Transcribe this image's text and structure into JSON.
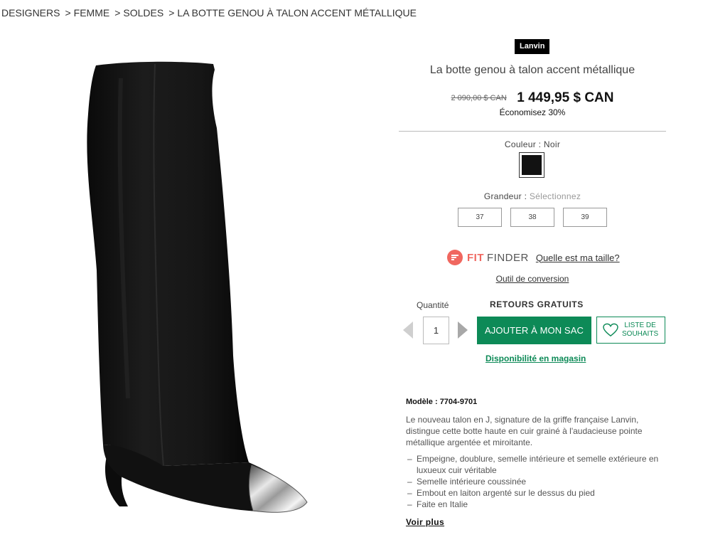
{
  "breadcrumb": {
    "items": [
      "DESIGNERS",
      "FEMME",
      "SOLDES",
      "LA BOTTE GENOU À TALON ACCENT MÉTALLIQUE"
    ],
    "separator": ">"
  },
  "product": {
    "brand": "Lanvin",
    "title": "La botte genou à talon accent métallique",
    "old_price": "2 090,00 $ CAN",
    "price": "1 449,95 $ CAN",
    "savings": "Économisez 30%",
    "image_icon": "knee-boot-image"
  },
  "color": {
    "label": "Couleur",
    "separator": ":",
    "value": "Noir",
    "swatch_hex": "#121212"
  },
  "size": {
    "label": "Grandeur",
    "separator": ":",
    "hint": "Sélectionnez",
    "options": [
      "37",
      "38",
      "39"
    ]
  },
  "fitfinder": {
    "fit": "FIT",
    "finder": "FINDER",
    "link": "Quelle est ma taille?",
    "accent": "#f0675f"
  },
  "conversion_link": "Outil de conversion",
  "purchase": {
    "quantity_label": "Quantité",
    "quantity_value": "1",
    "free_returns": "RETOURS GRATUITS",
    "add_to_bag": "AJOUTER À MON SAC",
    "wishlist_line1": "LISTE DE",
    "wishlist_line2": "SOUHAITS",
    "store_availability": "Disponibilité en magasin",
    "accent": "#0d8a57"
  },
  "details": {
    "model_label": "Modèle :",
    "model_value": "7704-9701",
    "description": "Le nouveau talon en J, signature de la griffe française Lanvin, distingue cette botte haute en cuir grainé à l'audacieuse pointe métallique argentée et miroitante.",
    "features": [
      "Empeigne, doublure, semelle intérieure et semelle extérieure en luxueux cuir véritable",
      "Semelle intérieure coussinée",
      "Embout en laiton argenté sur le dessus du pied",
      "Faite en Italie"
    ],
    "see_more": "Voir plus"
  }
}
